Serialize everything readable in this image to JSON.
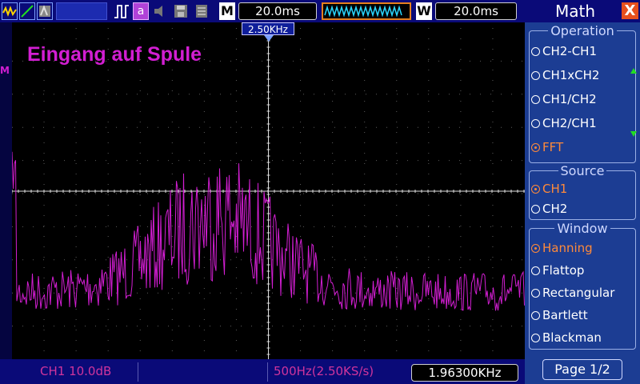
{
  "toolbar": {
    "mode_letter": "M",
    "timebase": "20.0ms",
    "window_letter": "W",
    "window_time": "20.0ms"
  },
  "trace_title": "Eingang auf Spule",
  "cursor_marker": "2.50KHz",
  "left_marker": "M",
  "bottom": {
    "ch1_label": "CH1 10.0dB",
    "freq_label": "500Hz(2.50KS/s)",
    "measurement": "1.96300KHz"
  },
  "panel": {
    "title": "Math",
    "close": "X",
    "operation_title": "Operation",
    "operations": [
      "CH2-CH1",
      "CH1xCH2",
      "CH1/CH2",
      "CH2/CH1",
      "FFT"
    ],
    "source_title": "Source",
    "sources": [
      "CH1",
      "CH2"
    ],
    "window_title": "Window",
    "windows": [
      "Hanning",
      "Flattop",
      "Rectangular",
      "Bartlett",
      "Blackman"
    ],
    "page": "Page 1/2",
    "selected_operation": "FFT",
    "selected_source": "CH1",
    "selected_window": "Hanning"
  },
  "colors": {
    "trace": "#d21ed2",
    "selected": "#ff8a3a",
    "panel_bg": "#1c3d93",
    "bar_bg": "#0a0a78"
  }
}
